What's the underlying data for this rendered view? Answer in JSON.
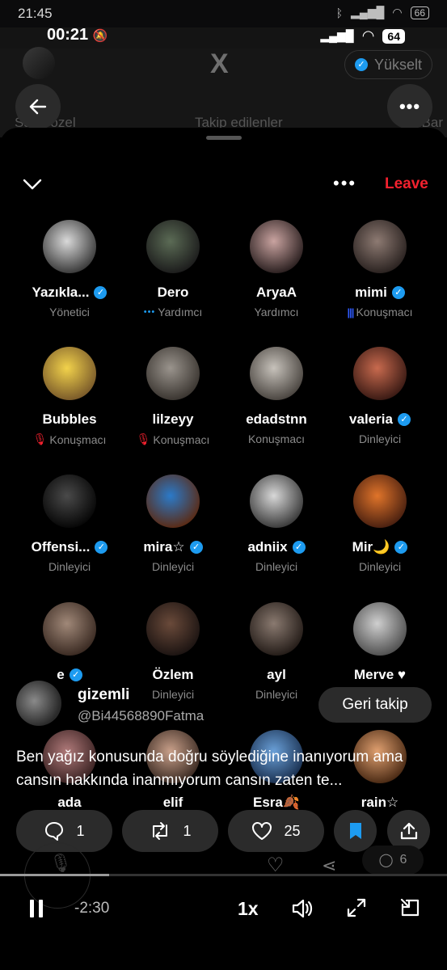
{
  "outer_status": {
    "time": "21:45",
    "battery": "66"
  },
  "inner_status": {
    "time": "00:21",
    "battery": "64"
  },
  "background_app": {
    "logo": "X",
    "upgrade_label": "Yükselt",
    "tabs": [
      "Sana özel",
      "Takip edilenler",
      "BelBar"
    ]
  },
  "space": {
    "leave_label": "Leave"
  },
  "participants": [
    {
      "name": "Yazıkla...",
      "verified": true,
      "role": "Yönetici",
      "role_icon": "",
      "avatar": [
        "#d9d9d9",
        "#3a3a3a"
      ]
    },
    {
      "name": "Dero",
      "verified": false,
      "role": "Yardımcı",
      "role_icon": "dots",
      "avatar": [
        "#5b6b55",
        "#1c1c1c"
      ]
    },
    {
      "name": "AryaA",
      "verified": false,
      "role": "Yardımcı",
      "role_icon": "",
      "avatar": [
        "#c9a3a0",
        "#2b2020"
      ]
    },
    {
      "name": "mimi",
      "verified": true,
      "role": "Konuşmacı",
      "role_icon": "bars",
      "avatar": [
        "#8d7a72",
        "#2a2220"
      ]
    },
    {
      "name": "Bubbles",
      "verified": false,
      "role": "Konuşmacı",
      "role_icon": "mute",
      "avatar": [
        "#f2d24b",
        "#7a5a2a"
      ]
    },
    {
      "name": "lilzeyy",
      "verified": false,
      "role": "Konuşmacı",
      "role_icon": "mute",
      "avatar": [
        "#9a948d",
        "#3a3530"
      ]
    },
    {
      "name": "edadstnn",
      "verified": false,
      "role": "Konuşmacı",
      "role_icon": "",
      "avatar": [
        "#c7c2bb",
        "#4a4540"
      ]
    },
    {
      "name": "valeria",
      "verified": true,
      "role": "Dinleyici",
      "role_icon": "",
      "avatar": [
        "#c86a4e",
        "#3a1a14"
      ]
    },
    {
      "name": "Offensi...",
      "verified": true,
      "role": "Dinleyici",
      "role_icon": "",
      "avatar": [
        "#4a4a4a",
        "#060606"
      ]
    },
    {
      "name": "mira☆",
      "verified": true,
      "role": "Dinleyici",
      "role_icon": "",
      "avatar": [
        "#2b7ac9",
        "#5a2a14"
      ]
    },
    {
      "name": "adniix",
      "verified": true,
      "role": "Dinleyici",
      "role_icon": "",
      "avatar": [
        "#d8d8d8",
        "#3a3a3a"
      ]
    },
    {
      "name": "Mir🌙",
      "verified": true,
      "role": "Dinleyici",
      "role_icon": "",
      "avatar": [
        "#e0742a",
        "#4a2010"
      ]
    },
    {
      "name": "e",
      "verified": true,
      "role": "",
      "role_icon": "",
      "avatar": [
        "#a08878",
        "#3a2a22"
      ]
    },
    {
      "name": "Özlem",
      "verified": false,
      "role": "Dinleyici",
      "role_icon": "",
      "avatar": [
        "#6a4a3a",
        "#1c1412"
      ]
    },
    {
      "name": "ayl",
      "verified": false,
      "role": "Dinleyici",
      "role_icon": "",
      "avatar": [
        "#8a7a70",
        "#241c18"
      ]
    },
    {
      "name": "Merve ♥",
      "verified": false,
      "role": "",
      "role_icon": "",
      "avatar": [
        "#cfcfcf",
        "#505050"
      ]
    },
    {
      "name": "ada",
      "verified": false,
      "role": "",
      "role_icon": "",
      "avatar": [
        "#b07a7a",
        "#3a2222"
      ]
    },
    {
      "name": "elif",
      "verified": false,
      "role": "",
      "role_icon": "",
      "avatar": [
        "#c9a08a",
        "#3a2a22"
      ]
    },
    {
      "name": "Esra🍂",
      "verified": false,
      "role": "",
      "role_icon": "",
      "avatar": [
        "#6aa0d8",
        "#1a3050"
      ]
    },
    {
      "name": "rain☆",
      "verified": false,
      "role": "",
      "role_icon": "",
      "avatar": [
        "#e0a070",
        "#4a2a14"
      ]
    }
  ],
  "tweet": {
    "name": "gizemli",
    "handle": "@Bi44568890Fatma",
    "follow_label": "Geri takip",
    "text": "Ben yağız konusunda doğru söylediğine inanıyorum ama cansın hakkında inanmıyorum cansın zaten te..."
  },
  "actions": {
    "replies": "1",
    "reposts": "1",
    "likes": "25"
  },
  "background_row": {
    "comments": "6"
  },
  "player": {
    "remaining": "-2:30",
    "speed": "1x",
    "progress": 0.245
  },
  "colors": {
    "accent": "#1d9bf0",
    "leave": "#f4212e"
  }
}
